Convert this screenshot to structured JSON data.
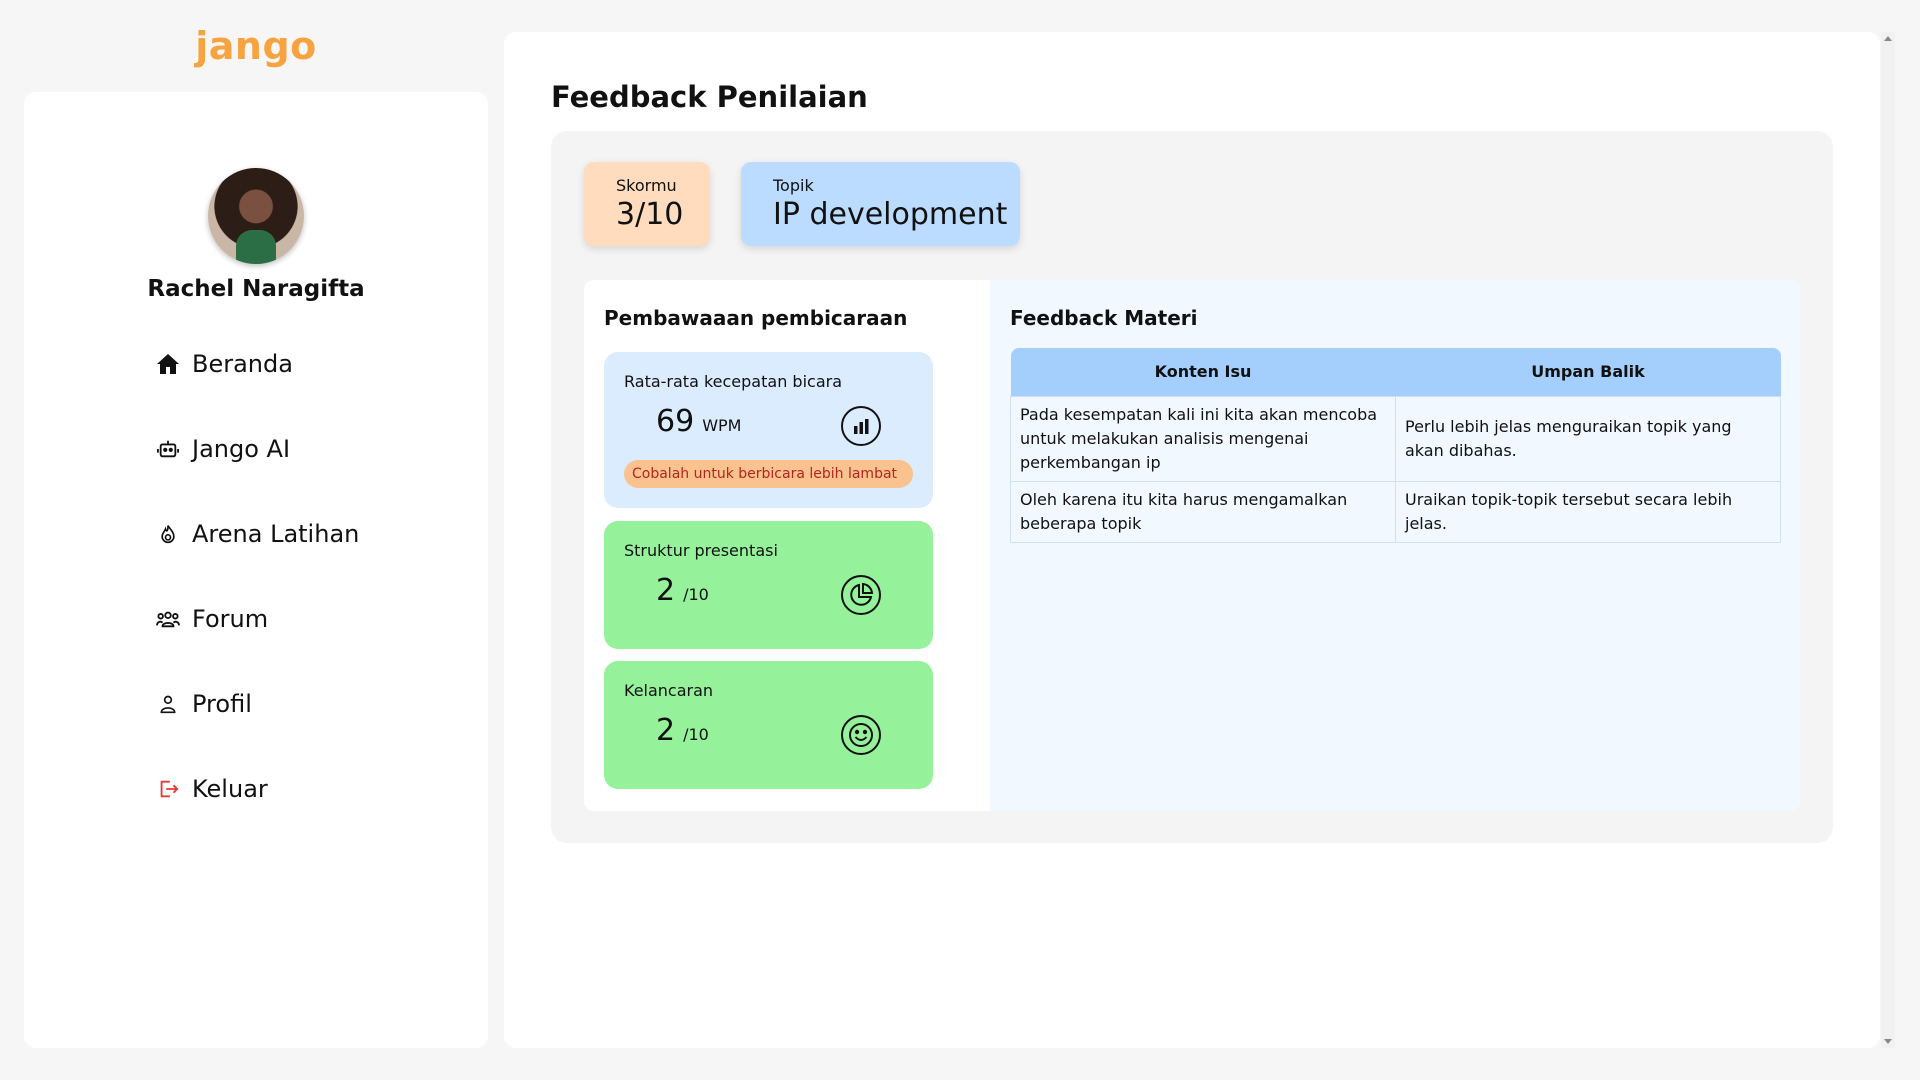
{
  "brand": {
    "logo_text": "jango",
    "logo_color": "#f7a440"
  },
  "user": {
    "name": "Rachel Naragifta"
  },
  "sidebar": {
    "items": [
      {
        "label": "Beranda",
        "icon": "home-icon"
      },
      {
        "label": "Jango AI",
        "icon": "robot-icon"
      },
      {
        "label": "Arena Latihan",
        "icon": "fire-icon"
      },
      {
        "label": "Forum",
        "icon": "group-icon"
      },
      {
        "label": "Profil",
        "icon": "user-icon"
      },
      {
        "label": "Keluar",
        "icon": "logout-icon",
        "color": "#e53935"
      }
    ]
  },
  "page": {
    "title": "Feedback Penilaian"
  },
  "summary": {
    "score_label": "Skormu",
    "score_value": "3/10",
    "topic_label": "Topik",
    "topic_value": "IP development"
  },
  "delivery": {
    "title": "Pembawaaan pembicaraan",
    "speed": {
      "label": "Rata-rata kecepatan bicara",
      "value": "69",
      "unit": "WPM",
      "tip": "Cobalah untuk berbicara lebih lambat",
      "icon": "bar-chart-icon"
    },
    "structure": {
      "label": "Struktur presentasi",
      "value": "2",
      "unit": "/10",
      "icon": "pie-chart-icon"
    },
    "fluency": {
      "label": "Kelancaran",
      "value": "2",
      "unit": "/10",
      "icon": "smile-icon"
    }
  },
  "materi": {
    "title": "Feedback Materi",
    "columns": [
      "Konten Isu",
      "Umpan Balik"
    ],
    "rows": [
      [
        "Pada kesempatan kali ini kita akan mencoba untuk melakukan analisis mengenai perkembangan ip",
        "Perlu lebih jelas menguraikan topik yang akan dibahas."
      ],
      [
        "Oleh karena itu kita harus mengamalkan beberapa topik",
        "Uraikan topik-topik tersebut secara lebih jelas."
      ]
    ]
  }
}
